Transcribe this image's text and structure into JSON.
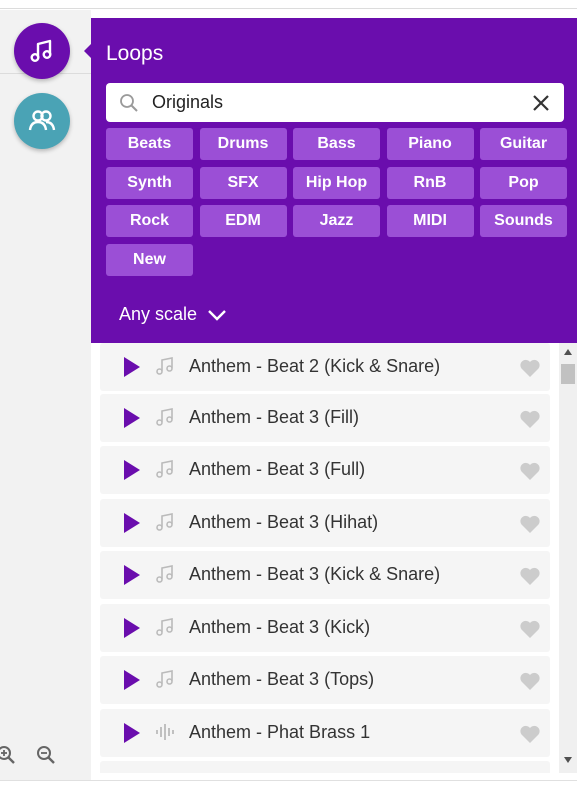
{
  "colors": {
    "accent": "#6a0dad",
    "chip": "#9b4fd6",
    "collab": "#4aa3b5"
  },
  "rail": {
    "loops_icon": "music-notes-icon",
    "collab_icon": "people-icon",
    "zoom_in_icon": "zoom-in-icon",
    "zoom_out_icon": "zoom-out-icon"
  },
  "panel": {
    "title": "Loops",
    "search": {
      "value": "Originals",
      "placeholder": ""
    },
    "filters": [
      "Beats",
      "Drums",
      "Bass",
      "Piano",
      "Guitar",
      "Synth",
      "SFX",
      "Hip Hop",
      "RnB",
      "Pop",
      "Rock",
      "EDM",
      "Jazz",
      "MIDI",
      "Sounds",
      "New"
    ],
    "scale_label": "Any scale"
  },
  "loops": [
    {
      "label": "Anthem - Beat 2 (Kick & Snare)",
      "icon": "music-note-icon"
    },
    {
      "label": "Anthem - Beat 3 (Fill)",
      "icon": "music-note-icon"
    },
    {
      "label": "Anthem - Beat 3 (Full)",
      "icon": "music-note-icon"
    },
    {
      "label": "Anthem - Beat 3 (Hihat)",
      "icon": "music-note-icon"
    },
    {
      "label": "Anthem - Beat 3 (Kick & Snare)",
      "icon": "music-note-icon"
    },
    {
      "label": "Anthem - Beat 3 (Kick)",
      "icon": "music-note-icon"
    },
    {
      "label": "Anthem - Beat 3 (Tops)",
      "icon": "music-note-icon"
    },
    {
      "label": "Anthem - Phat Brass 1",
      "icon": "waveform-icon"
    }
  ]
}
